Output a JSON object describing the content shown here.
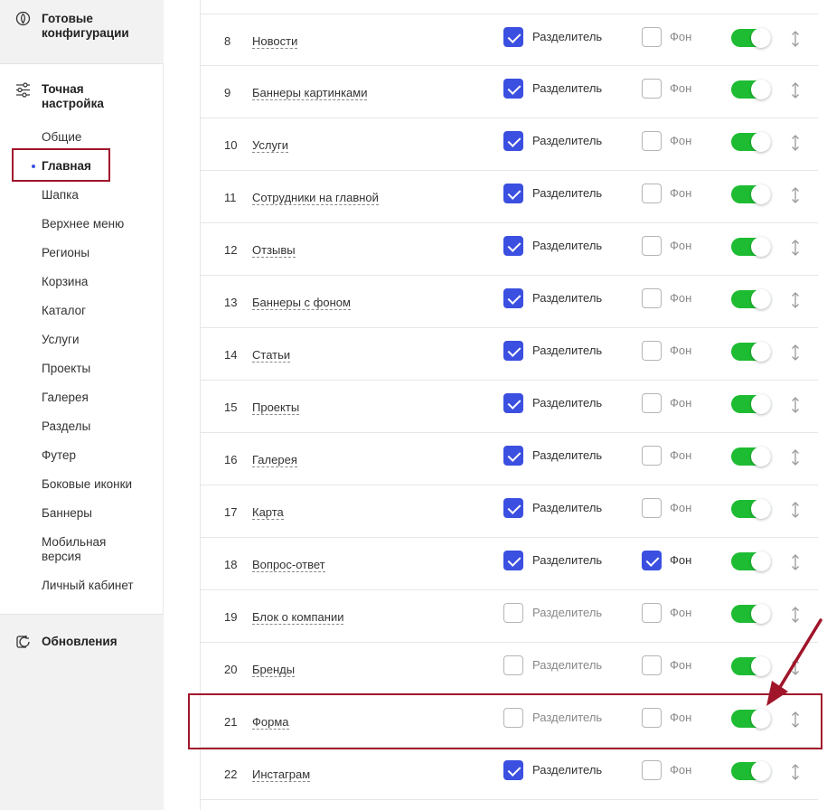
{
  "sidebar": {
    "top_section": {
      "label": "Готовые конфигурации",
      "icon": "palette-icon"
    },
    "fine_tune": {
      "label": "Точная настройка",
      "icon": "sliders-icon"
    },
    "items": [
      {
        "label": "Общие"
      },
      {
        "label": "Главная",
        "active": true
      },
      {
        "label": "Шапка"
      },
      {
        "label": "Верхнее меню"
      },
      {
        "label": "Регионы"
      },
      {
        "label": "Корзина"
      },
      {
        "label": "Каталог"
      },
      {
        "label": "Услуги"
      },
      {
        "label": "Проекты"
      },
      {
        "label": "Галерея"
      },
      {
        "label": "Разделы"
      },
      {
        "label": "Футер"
      },
      {
        "label": "Боковые иконки"
      },
      {
        "label": "Баннеры"
      },
      {
        "label": "Мобильная версия"
      },
      {
        "label": "Личный кабинет"
      }
    ],
    "updates": {
      "label": "Обновления",
      "icon": "refresh-icon"
    }
  },
  "labels": {
    "separator": "Разделитель",
    "background": "Фон"
  },
  "rows": [
    {
      "num": "8",
      "name": "Новости",
      "separator": true,
      "background": false,
      "enabled": true
    },
    {
      "num": "9",
      "name": "Баннеры картинками",
      "separator": true,
      "background": false,
      "enabled": true
    },
    {
      "num": "10",
      "name": "Услуги",
      "separator": true,
      "background": false,
      "enabled": true
    },
    {
      "num": "11",
      "name": "Сотрудники на главной",
      "separator": true,
      "background": false,
      "enabled": true
    },
    {
      "num": "12",
      "name": "Отзывы",
      "separator": true,
      "background": false,
      "enabled": true
    },
    {
      "num": "13",
      "name": "Баннеры с фоном",
      "separator": true,
      "background": false,
      "enabled": true
    },
    {
      "num": "14",
      "name": "Статьи",
      "separator": true,
      "background": false,
      "enabled": true
    },
    {
      "num": "15",
      "name": "Проекты",
      "separator": true,
      "background": false,
      "enabled": true
    },
    {
      "num": "16",
      "name": "Галерея",
      "separator": true,
      "background": false,
      "enabled": true
    },
    {
      "num": "17",
      "name": "Карта",
      "separator": true,
      "background": false,
      "enabled": true
    },
    {
      "num": "18",
      "name": "Вопрос-ответ",
      "separator": true,
      "background": true,
      "enabled": true
    },
    {
      "num": "19",
      "name": "Блок о компании",
      "separator": false,
      "background": false,
      "enabled": true
    },
    {
      "num": "20",
      "name": "Бренды",
      "separator": false,
      "background": false,
      "enabled": true
    },
    {
      "num": "21",
      "name": "Форма",
      "separator": false,
      "background": false,
      "enabled": true,
      "highlighted": true
    },
    {
      "num": "22",
      "name": "Инстаграм",
      "separator": true,
      "background": false,
      "enabled": true
    }
  ],
  "colors": {
    "accent": "#3b4fe0",
    "toggle_on": "#1ebc33",
    "highlight": "#a0152a"
  }
}
